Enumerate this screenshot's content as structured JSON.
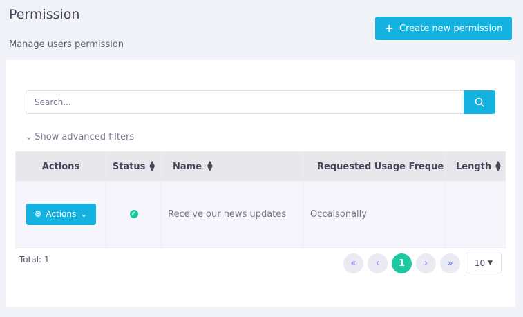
{
  "header": {
    "title": "Permission",
    "subtitle": "Manage users permission",
    "create_label": "Create new permission"
  },
  "search": {
    "placeholder": "Search...",
    "value": ""
  },
  "filters": {
    "advanced_label": "Show advanced filters"
  },
  "table": {
    "columns": {
      "actions": "Actions",
      "status": "Status",
      "name": "Name",
      "frequency": "Requested Usage Frequen",
      "length": "Length"
    },
    "rows": [
      {
        "actions_label": "Actions",
        "status": "active",
        "name": "Receive our news updates",
        "frequency": "Occaisonally",
        "length": ""
      }
    ]
  },
  "footer": {
    "total": "Total: 1",
    "current_page": "1",
    "page_size": "10"
  },
  "colors": {
    "accent": "#14b2e0",
    "success": "#1dc9a0"
  }
}
